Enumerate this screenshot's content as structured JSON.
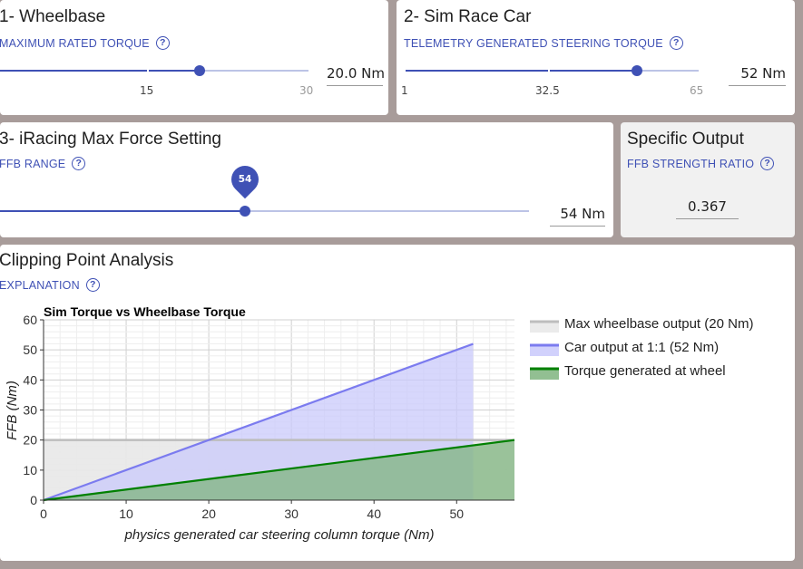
{
  "wheelbase": {
    "title": "1- Wheelbase",
    "subtitle": "MAXIMUM RATED TORQUE",
    "slider": {
      "min": 0,
      "max": 30,
      "value": 20,
      "mark_mid": "15",
      "mark_max": "30"
    },
    "value_text": "20.0 Nm"
  },
  "simcar": {
    "title": "2- Sim Race Car",
    "subtitle": "TELEMETRY GENERATED STEERING TORQUE",
    "slider": {
      "min": 1,
      "max": 65,
      "value": 52,
      "mark_min": "1",
      "mark_mid": "32.5",
      "mark_max": "65"
    },
    "value_text": "52 Nm"
  },
  "iracing": {
    "title": "3- iRacing Max Force Setting",
    "subtitle": "FFB RANGE",
    "slider": {
      "value": 54,
      "fill_fraction": 0.47,
      "tooltip": "54"
    },
    "value_text": "54 Nm"
  },
  "specific": {
    "title": "Specific Output",
    "subtitle": "FFB STRENGTH RATIO",
    "value_text": "0.367"
  },
  "clipping": {
    "title": "Clipping Point Analysis",
    "subtitle": "EXPLANATION"
  },
  "icons": {
    "help": "help-circle-icon"
  },
  "colors": {
    "accent": "#3f51b5",
    "max_line": "#bdbdbd",
    "car_line": "#7b7bef",
    "wheel_line": "#008000"
  },
  "chart_data": {
    "type": "line",
    "title": "Sim Torque vs Wheelbase Torque",
    "xlabel": "physics generated car steering column torque (Nm)",
    "ylabel": "FFB (Nm)",
    "xlim": [
      0,
      57
    ],
    "ylim": [
      0,
      60
    ],
    "xticks": [
      "0",
      "10",
      "20",
      "30",
      "40",
      "50"
    ],
    "yticks": [
      "0",
      "10",
      "20",
      "30",
      "40",
      "50",
      "60"
    ],
    "grid": true,
    "legend_position": "right",
    "series": [
      {
        "name": "Max wheelbase output (20 Nm)",
        "color": "#bdbdbd",
        "fill": "#e8e8e8",
        "x": [
          0,
          57
        ],
        "y": [
          20,
          20
        ]
      },
      {
        "name": "Car output at 1:1 (52 Nm)",
        "color": "#7b7bef",
        "fill": "#c9c9fb",
        "x": [
          0,
          52
        ],
        "y": [
          0,
          52
        ]
      },
      {
        "name": "Torque generated at wheel",
        "color": "#008000",
        "fill": "#7fb47f",
        "x": [
          0,
          57
        ],
        "y": [
          0,
          20
        ]
      }
    ]
  }
}
